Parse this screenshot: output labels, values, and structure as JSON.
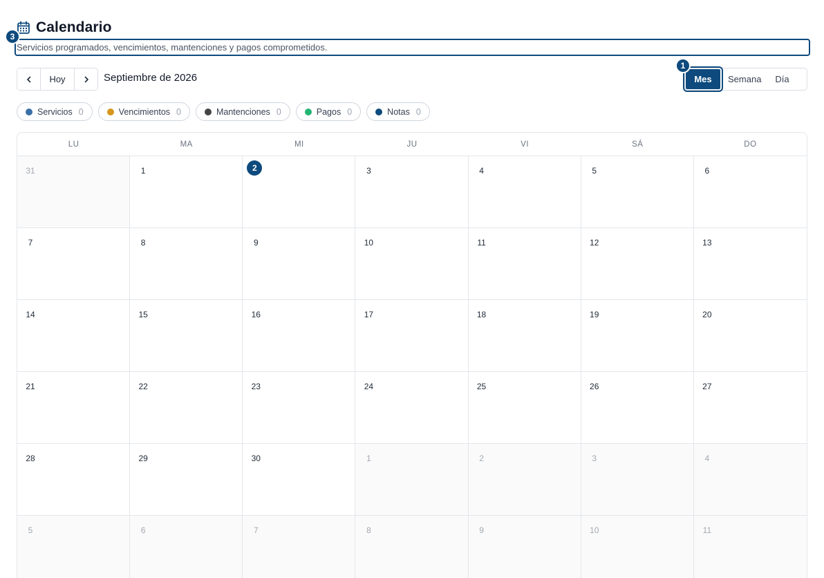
{
  "header": {
    "title": "Calendario",
    "subtitle": "Servicios programados, vencimientos, mantenciones y pagos comprometidos."
  },
  "markers": {
    "m1": "1",
    "m2": "3"
  },
  "toolbar": {
    "prev_icon": "chevron-left-icon",
    "today_label": "Hoy",
    "next_icon": "chevron-right-icon",
    "period_label": "Septiembre de 2026"
  },
  "views": [
    {
      "label": "Mes",
      "active": true
    },
    {
      "label": "Semana",
      "active": false
    },
    {
      "label": "Día",
      "active": false
    }
  ],
  "filters": [
    {
      "label": "Servicios",
      "count": "0",
      "color": "#3a6fa8"
    },
    {
      "label": "Vencimientos",
      "count": "0",
      "color": "#d4961c"
    },
    {
      "label": "Mantenciones",
      "count": "0",
      "color": "#444444"
    },
    {
      "label": "Pagos",
      "count": "0",
      "color": "#22b573"
    },
    {
      "label": "Notas",
      "count": "0",
      "color": "#0e4a7d"
    }
  ],
  "weekdays": [
    "LU",
    "MA",
    "MI",
    "JU",
    "VI",
    "SÁ",
    "DO"
  ],
  "days": [
    {
      "n": "31",
      "outside": true
    },
    {
      "n": "1"
    },
    {
      "n": "2",
      "today": true
    },
    {
      "n": "3"
    },
    {
      "n": "4"
    },
    {
      "n": "5"
    },
    {
      "n": "6"
    },
    {
      "n": "7"
    },
    {
      "n": "8"
    },
    {
      "n": "9"
    },
    {
      "n": "10"
    },
    {
      "n": "11"
    },
    {
      "n": "12"
    },
    {
      "n": "13"
    },
    {
      "n": "14"
    },
    {
      "n": "15"
    },
    {
      "n": "16"
    },
    {
      "n": "17"
    },
    {
      "n": "18"
    },
    {
      "n": "19"
    },
    {
      "n": "20"
    },
    {
      "n": "21"
    },
    {
      "n": "22"
    },
    {
      "n": "23"
    },
    {
      "n": "24"
    },
    {
      "n": "25"
    },
    {
      "n": "26"
    },
    {
      "n": "27"
    },
    {
      "n": "28"
    },
    {
      "n": "29"
    },
    {
      "n": "30"
    },
    {
      "n": "1",
      "outside": true
    },
    {
      "n": "2",
      "outside": true
    },
    {
      "n": "3",
      "outside": true
    },
    {
      "n": "4",
      "outside": true
    },
    {
      "n": "5",
      "outside": true
    },
    {
      "n": "6",
      "outside": true
    },
    {
      "n": "7",
      "outside": true
    },
    {
      "n": "8",
      "outside": true
    },
    {
      "n": "9",
      "outside": true
    },
    {
      "n": "10",
      "outside": true
    },
    {
      "n": "11",
      "outside": true
    }
  ],
  "colors": {
    "accent": "#0e4a7d"
  }
}
